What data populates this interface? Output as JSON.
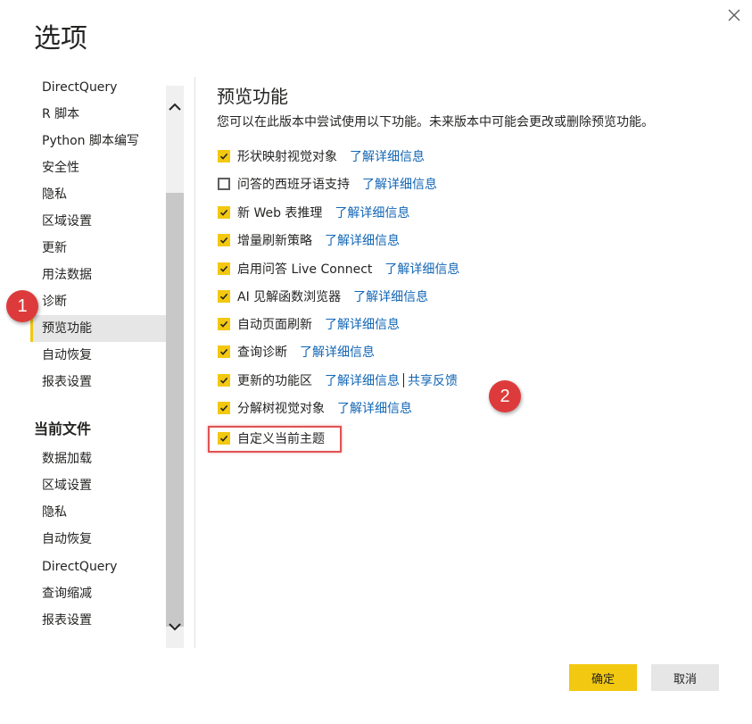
{
  "dialog": {
    "title": "选项"
  },
  "sidebar": {
    "global_items": [
      {
        "label": "DirectQuery"
      },
      {
        "label": "R 脚本"
      },
      {
        "label": "Python 脚本编写"
      },
      {
        "label": "安全性"
      },
      {
        "label": "隐私"
      },
      {
        "label": "区域设置"
      },
      {
        "label": "更新"
      },
      {
        "label": "用法数据"
      },
      {
        "label": "诊断"
      },
      {
        "label": "预览功能"
      },
      {
        "label": "自动恢复"
      },
      {
        "label": "报表设置"
      }
    ],
    "selected_item": "预览功能",
    "current_file_heading": "当前文件",
    "file_items": [
      {
        "label": "数据加载"
      },
      {
        "label": "区域设置"
      },
      {
        "label": "隐私"
      },
      {
        "label": "自动恢复"
      },
      {
        "label": "DirectQuery"
      },
      {
        "label": "查询缩减"
      },
      {
        "label": "报表设置"
      }
    ]
  },
  "main": {
    "title": "预览功能",
    "description": "您可以在此版本中尝试使用以下功能。未来版本中可能会更改或删除预览功能。",
    "learn_more": "了解详细信息",
    "share_feedback": "共享反馈",
    "options": [
      {
        "label": "形状映射视觉对象",
        "checked": true
      },
      {
        "label": "问答的西班牙语支持",
        "checked": false
      },
      {
        "label": "新 Web 表推理",
        "checked": true
      },
      {
        "label": "增量刷新策略",
        "checked": true
      },
      {
        "label": "启用问答 Live Connect",
        "checked": true
      },
      {
        "label": "AI 见解函数浏览器",
        "checked": true
      },
      {
        "label": "自动页面刷新",
        "checked": true
      },
      {
        "label": "查询诊断",
        "checked": true
      },
      {
        "label": "更新的功能区",
        "checked": true
      },
      {
        "label": "分解树视觉对象",
        "checked": true
      },
      {
        "label": "自定义当前主题",
        "checked": true
      }
    ]
  },
  "annotations": {
    "marker1": "1",
    "marker2": "2"
  },
  "buttons": {
    "ok": "确定",
    "cancel": "取消"
  },
  "colors": {
    "accent": "#f2c811",
    "link": "#1266b5",
    "annotation": "#dd3b3b"
  }
}
